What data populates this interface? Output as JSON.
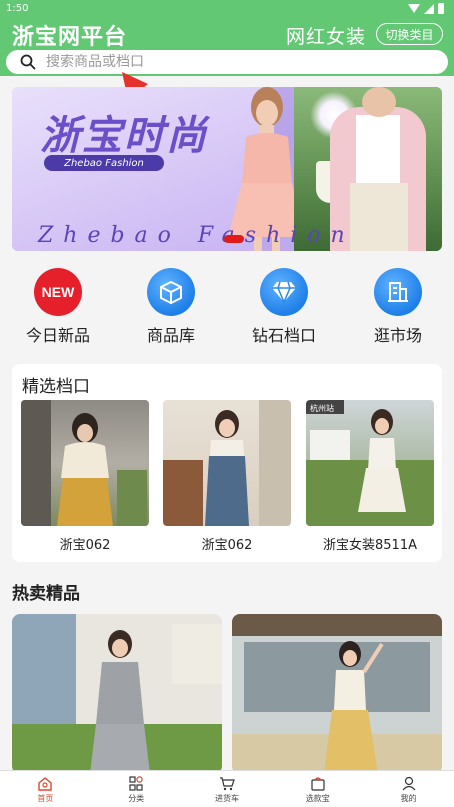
{
  "status_bar": {
    "time": "1:50"
  },
  "header": {
    "app_title": "浙宝网平台",
    "category_name": "网红女装",
    "switch_label": "切换类目"
  },
  "search": {
    "placeholder": "搜索商品或档口"
  },
  "banner": {
    "title": "浙宝时尚",
    "pill": "Zhebao Fashion",
    "subtitle": "Zhebao Fashion"
  },
  "quick_entries": [
    {
      "label": "今日新品",
      "icon": "new-badge-icon",
      "badge": "NEW"
    },
    {
      "label": "商品库",
      "icon": "box-icon"
    },
    {
      "label": "钻石档口",
      "icon": "diamond-icon"
    },
    {
      "label": "逛市场",
      "icon": "building-icon"
    }
  ],
  "featured": {
    "title": "精选档口",
    "stalls": [
      {
        "name": "浙宝062"
      },
      {
        "name": "浙宝062"
      },
      {
        "name": "浙宝女装8511A",
        "tag": "杭州站"
      }
    ]
  },
  "hot": {
    "title": "热卖精品"
  },
  "tabbar": {
    "items": [
      {
        "label": "首页",
        "icon": "home-icon"
      },
      {
        "label": "分类",
        "icon": "category-icon"
      },
      {
        "label": "进货车",
        "icon": "cart-icon"
      },
      {
        "label": "选款宝",
        "icon": "bag-icon"
      },
      {
        "label": "我的",
        "icon": "user-icon"
      }
    ],
    "active_index": 0
  },
  "colors": {
    "header": "#63c874",
    "accent": "#e0452e",
    "banner": "#b7a2ea"
  }
}
